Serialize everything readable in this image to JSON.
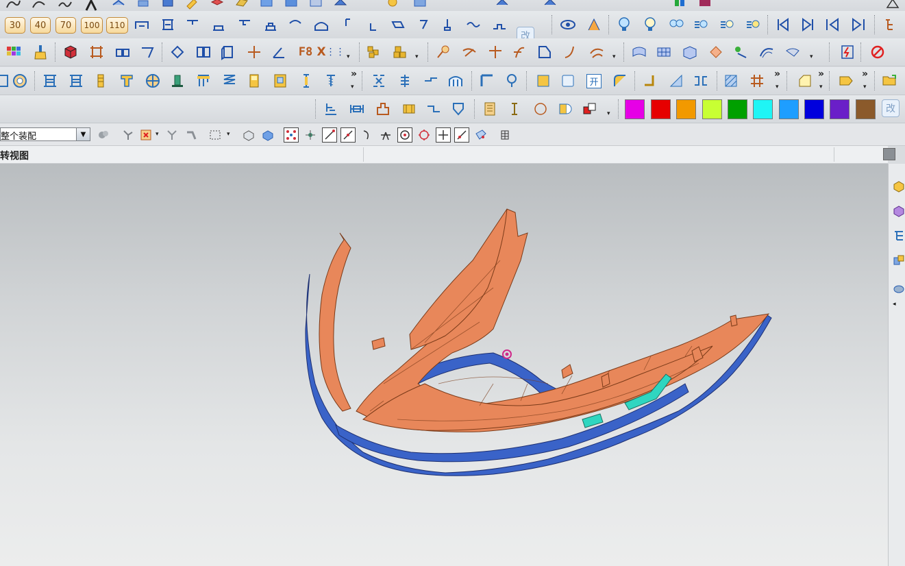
{
  "toolbar_row2": {
    "layer_buttons": [
      "30",
      "40",
      "70",
      "100",
      "110"
    ],
    "gai_label": "改"
  },
  "toolbar_row3": {
    "f8_label": "F8",
    "x_label": "X"
  },
  "toolbar_row5": {
    "kai_label": "开",
    "gai_label": "改",
    "colors": [
      "#e600e6",
      "#e60000",
      "#f29900",
      "#c8ff33",
      "#00a000",
      "#1ff5f5",
      "#1e9eff",
      "#0000dd",
      "#6a1fc8",
      "#8b5a2b"
    ]
  },
  "selection_bar": {
    "assembly_filter_value": "整个装配"
  },
  "viewport": {
    "title": "转视图",
    "model_colors": {
      "main": "#e8875a",
      "secondary": "#3a63c8",
      "highlight": "#2fd6c0"
    }
  }
}
